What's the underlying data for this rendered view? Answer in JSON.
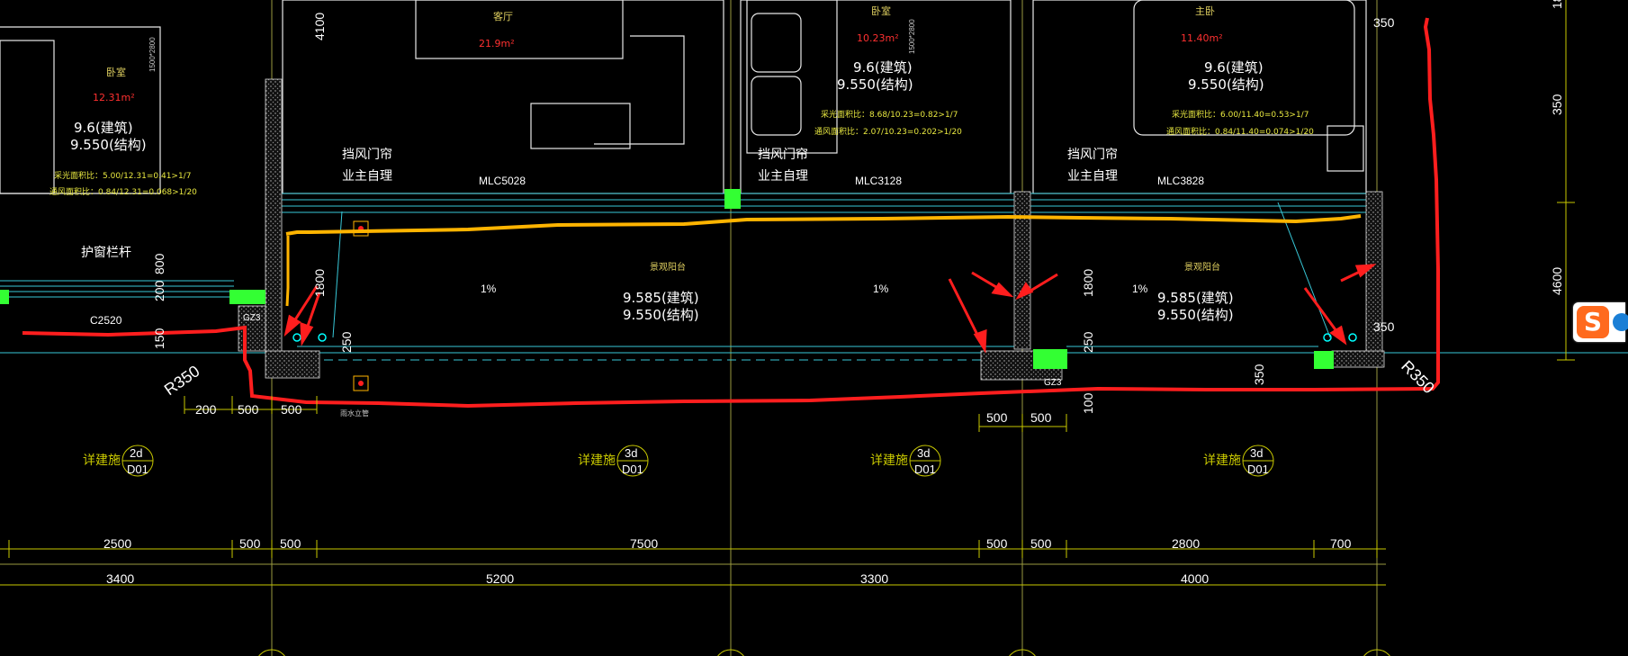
{
  "rooms": {
    "bedroom_left": {
      "name": "卧室",
      "area": "12.31m²",
      "dim": "1500*2800",
      "h1": "9.6(建筑)",
      "h2": "9.550(结构)",
      "r1": "采光面积比：5.00/12.31=0.41>1/7",
      "r2": "通风面积比：0.84/12.31=0.068>1/20"
    },
    "living": {
      "name": "客厅",
      "area": "21.9m²"
    },
    "bedroom_mid": {
      "name": "卧室",
      "area": "10.23m²",
      "dim": "1500*2800",
      "h1": "9.6(建筑)",
      "h2": "9.550(结构)",
      "r1": "采光面积比：8.68/10.23=0.82>1/7",
      "r2": "通风面积比：2.07/10.23=0.202>1/20"
    },
    "master": {
      "name": "主卧",
      "area": "11.40m²",
      "h1": "9.6(建筑)",
      "h2": "9.550(结构)",
      "r1": "采光面积比：6.00/11.40=0.53>1/7",
      "r2": "通风面积比：0.84/11.40=0.074>1/20"
    }
  },
  "labels": {
    "wind_curtain": "挡风门帘",
    "owner": "业主自理",
    "guard_rail": "护窗栏杆",
    "balcony": "景观阳台",
    "mlc1": "MLC5028",
    "mlc2": "MLC3128",
    "mlc3": "MLC3828",
    "c2520": "C2520",
    "gz3a": "GZ3",
    "gz3b": "GZ3",
    "slope": "1%",
    "bal_h1": "9.585(建筑)",
    "bal_h2": "9.550(结构)",
    "r350": "R350",
    "r350b": "R350",
    "drain": "雨水立管"
  },
  "details": [
    {
      "text": "详建施",
      "num": "2d",
      "ref": "D01"
    },
    {
      "text": "详建施",
      "num": "3d",
      "ref": "D01"
    },
    {
      "text": "详建施",
      "num": "3d",
      "ref": "D01"
    },
    {
      "text": "详建施",
      "num": "3d",
      "ref": "D01"
    }
  ],
  "dims": {
    "row1": [
      "2500",
      "500",
      "500",
      "7500",
      "500",
      "500",
      "2800",
      "700"
    ],
    "row2": [
      "3400",
      "5200",
      "3300",
      "4000"
    ],
    "small": [
      "200",
      "500",
      "500",
      "500",
      "500"
    ],
    "vert": [
      "4100",
      "1800",
      "250",
      "800",
      "200",
      "150",
      "1800",
      "250",
      "100",
      "350",
      "350",
      "350",
      "4600",
      "1800"
    ]
  },
  "colors": {
    "wall": "#ffffff",
    "axis": "#ffff00",
    "dim": "#c8c800",
    "red_markup": "#ff1e1e",
    "yellow_markup": "#ffb400",
    "green": "#33ff33",
    "cyan": "#00ffff"
  }
}
